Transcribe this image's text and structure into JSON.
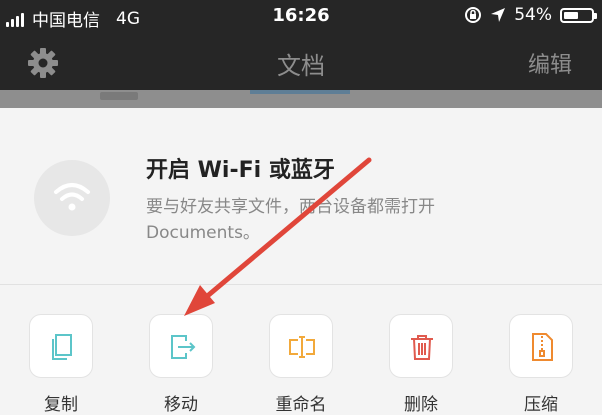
{
  "status_bar": {
    "carrier": "中国电信",
    "network": "4G",
    "time": "16:26",
    "battery_percent": "54%",
    "battery_level": 0.54
  },
  "nav_bar": {
    "title": "文档",
    "edit_label": "编辑",
    "settings_icon": "gear-icon"
  },
  "wifi_prompt": {
    "heading": "开启 Wi-Fi 或蓝牙",
    "description": "要与好友共享文件，两台设备都需打开 Documents。",
    "icon": "wifi-icon"
  },
  "actions": [
    {
      "label": "复制",
      "icon": "copy-icon",
      "color": "#5cc5c9"
    },
    {
      "label": "移动",
      "icon": "move-icon",
      "color": "#5cc5c9"
    },
    {
      "label": "重命名",
      "icon": "rename-icon",
      "color": "#f2a93b"
    },
    {
      "label": "删除",
      "icon": "trash-icon",
      "color": "#e05a4e"
    },
    {
      "label": "压缩",
      "icon": "zip-icon",
      "color": "#ef8a2f"
    }
  ],
  "annotation": {
    "color": "#e0463a"
  }
}
